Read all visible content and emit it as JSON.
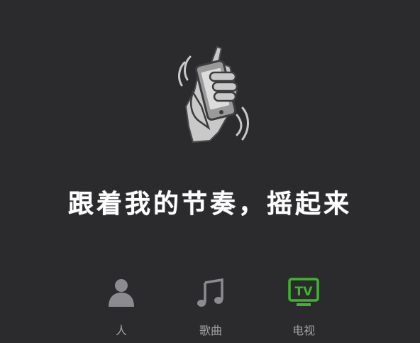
{
  "slogan": "跟着我的节奏，摇起来",
  "tabs": [
    {
      "label": "人",
      "icon": "person-icon"
    },
    {
      "label": "歌曲",
      "icon": "music-note-icon"
    },
    {
      "label": "电视",
      "icon": "tv-icon",
      "icon_text": "TV",
      "selected": true
    }
  ],
  "colors": {
    "background": "#2b2b2e",
    "text": "#ffffff",
    "inactive": "#8c8c90",
    "accent": "#3fb52f"
  }
}
